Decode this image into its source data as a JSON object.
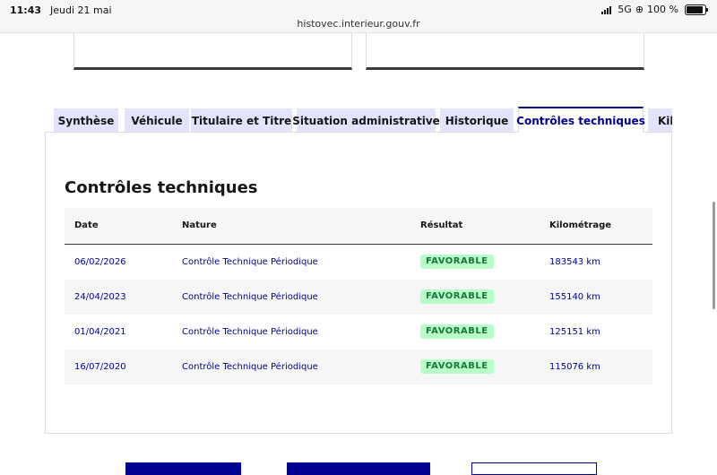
{
  "statusbar": {
    "time": "11:43",
    "date": "Jeudi 21 mai",
    "url": "histovec.interieur.gouv.fr",
    "network": "5G",
    "battery": "100 %",
    "battery_level": 1.0
  },
  "tabs": [
    {
      "label": "Synthèse",
      "active": false
    },
    {
      "label": "Véhicule",
      "active": false
    },
    {
      "label": "Titulaire et Titre",
      "active": false
    },
    {
      "label": "Situation administrative",
      "active": false
    },
    {
      "label": "Historique",
      "active": false
    },
    {
      "label": "Contrôles techniques",
      "active": true
    },
    {
      "label": "Kilométrage",
      "active": false
    }
  ],
  "section": {
    "title": "Contrôles techniques"
  },
  "table": {
    "headers": [
      "Date",
      "Nature",
      "Résultat",
      "Kilométrage"
    ],
    "rows": [
      {
        "date": "06/02/2026",
        "nature": "Contrôle Technique Périodique",
        "result": "FAVORABLE",
        "km": "183543 km"
      },
      {
        "date": "24/04/2023",
        "nature": "Contrôle Technique Périodique",
        "result": "FAVORABLE",
        "km": "155140 km"
      },
      {
        "date": "01/04/2021",
        "nature": "Contrôle Technique Périodique",
        "result": "FAVORABLE",
        "km": "125151 km"
      },
      {
        "date": "16/07/2020",
        "nature": "Contrôle Technique Périodique",
        "result": "FAVORABLE",
        "km": "115076 km"
      }
    ]
  },
  "colors": {
    "accent": "#000091",
    "tab_bg": "#e3e3fd",
    "badge_bg": "#b8fec9",
    "badge_text": "#18753c"
  }
}
